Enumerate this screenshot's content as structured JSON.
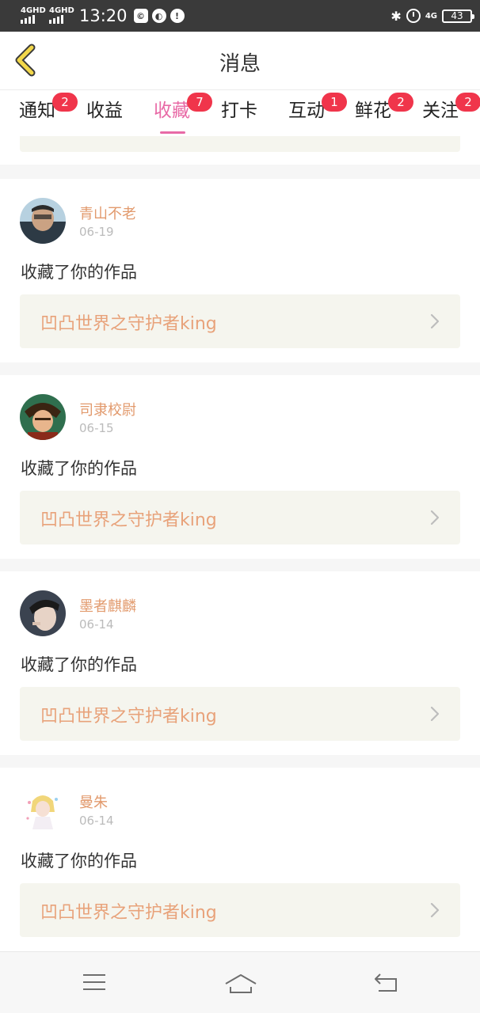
{
  "status_bar": {
    "signal1": "4GHD",
    "signal2": "4GHD",
    "time": "13:20",
    "icon_a": "©",
    "icon_b": "◐",
    "icon_c": "!",
    "network": "4G",
    "battery": "43"
  },
  "header": {
    "title": "消息"
  },
  "tabs": [
    {
      "label": "通知",
      "badge": "2"
    },
    {
      "label": "收益",
      "badge": ""
    },
    {
      "label": "收藏",
      "badge": "7",
      "active": true
    },
    {
      "label": "打卡",
      "badge": ""
    },
    {
      "label": "互动",
      "badge": "1"
    },
    {
      "label": "鲜花",
      "badge": "2"
    },
    {
      "label": "关注",
      "badge": "2"
    }
  ],
  "notifications": [
    {
      "user": "青山不老",
      "date": "06-19",
      "action": "收藏了你的作品",
      "work": "凹凸世界之守护者king"
    },
    {
      "user": "司隶校尉",
      "date": "06-15",
      "action": "收藏了你的作品",
      "work": "凹凸世界之守护者king"
    },
    {
      "user": "墨者麒麟",
      "date": "06-14",
      "action": "收藏了你的作品",
      "work": "凹凸世界之守护者king"
    },
    {
      "user": "曼朱",
      "date": "06-14",
      "action": "收藏了你的作品",
      "work": "凹凸世界之守护者king"
    }
  ],
  "colors": {
    "accent_pink": "#e86aa6",
    "badge_red": "#f0354b",
    "username_orange": "#e29a6d",
    "work_title_orange": "#e8a27a",
    "link_bg": "#f5f5ee",
    "back_arrow_yellow": "#f2d74a"
  },
  "icons": {
    "back": "chevron-left-icon",
    "chevron": "chevron-right-icon",
    "nav_menu": "menu-icon",
    "nav_home": "home-icon",
    "nav_back": "return-icon"
  }
}
